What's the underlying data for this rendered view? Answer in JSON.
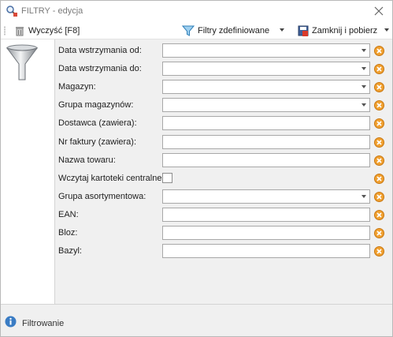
{
  "window": {
    "title": "FILTRY - edycja",
    "close_icon": "close-icon"
  },
  "toolbar": {
    "clear_label": "Wyczyść [F8]",
    "defined_filters_label": "Filtry zdefiniowane",
    "close_fetch_label": "Zamknij i pobierz"
  },
  "form": {
    "rows": [
      {
        "label": "Data wstrzymania od:",
        "type": "combo",
        "value": ""
      },
      {
        "label": "Data wstrzymania do:",
        "type": "combo",
        "value": ""
      },
      {
        "label": "Magazyn:",
        "type": "combo",
        "value": ""
      },
      {
        "label": "Grupa magazynów:",
        "type": "combo",
        "value": ""
      },
      {
        "label": "Dostawca (zawiera):",
        "type": "text",
        "value": ""
      },
      {
        "label": "Nr faktury (zawiera):",
        "type": "text",
        "value": ""
      },
      {
        "label": "Nazwa towaru:",
        "type": "text",
        "value": ""
      },
      {
        "label": "Wczytaj kartoteki centralne:",
        "type": "checkbox",
        "checked": false
      },
      {
        "label": "Grupa asortymentowa:",
        "type": "combo",
        "value": ""
      },
      {
        "label": "EAN:",
        "type": "text",
        "value": ""
      },
      {
        "label": "Bloz:",
        "type": "text",
        "value": ""
      },
      {
        "label": "Bazyl:",
        "type": "text",
        "value": ""
      }
    ]
  },
  "statusbar": {
    "text": "Filtrowanie"
  },
  "colors": {
    "clear_button": "#f0a030",
    "info_icon": "#3a7cc4"
  }
}
